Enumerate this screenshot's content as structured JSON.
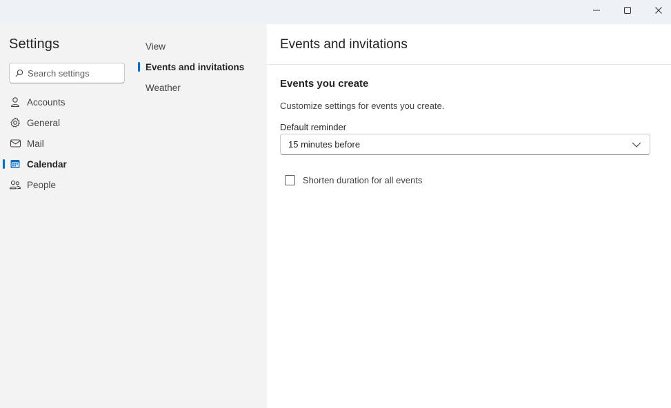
{
  "window": {
    "minimize_icon": "minimize-icon",
    "maximize_icon": "maximize-icon",
    "close_icon": "close-icon"
  },
  "sidebar": {
    "title": "Settings",
    "search_placeholder": "Search settings",
    "items": [
      {
        "label": "Accounts",
        "icon": "person-icon",
        "active": false
      },
      {
        "label": "General",
        "icon": "gear-icon",
        "active": false
      },
      {
        "label": "Mail",
        "icon": "mail-icon",
        "active": false
      },
      {
        "label": "Calendar",
        "icon": "calendar-icon",
        "active": true
      },
      {
        "label": "People",
        "icon": "people-icon",
        "active": false
      }
    ]
  },
  "subnav": {
    "items": [
      {
        "label": "View",
        "active": false
      },
      {
        "label": "Events and invitations",
        "active": true
      },
      {
        "label": "Weather",
        "active": false
      }
    ]
  },
  "content": {
    "title": "Events and invitations",
    "section_title": "Events you create",
    "section_desc": "Customize settings for events you create.",
    "reminder_label": "Default reminder",
    "reminder_value": "15 minutes before",
    "shorten_label": "Shorten duration for all events",
    "shorten_checked": false
  },
  "colors": {
    "accent": "#0f6cbd",
    "titlebar": "#eef2f6",
    "pane_bg": "#f3f3f3",
    "content_bg": "#ffffff"
  }
}
